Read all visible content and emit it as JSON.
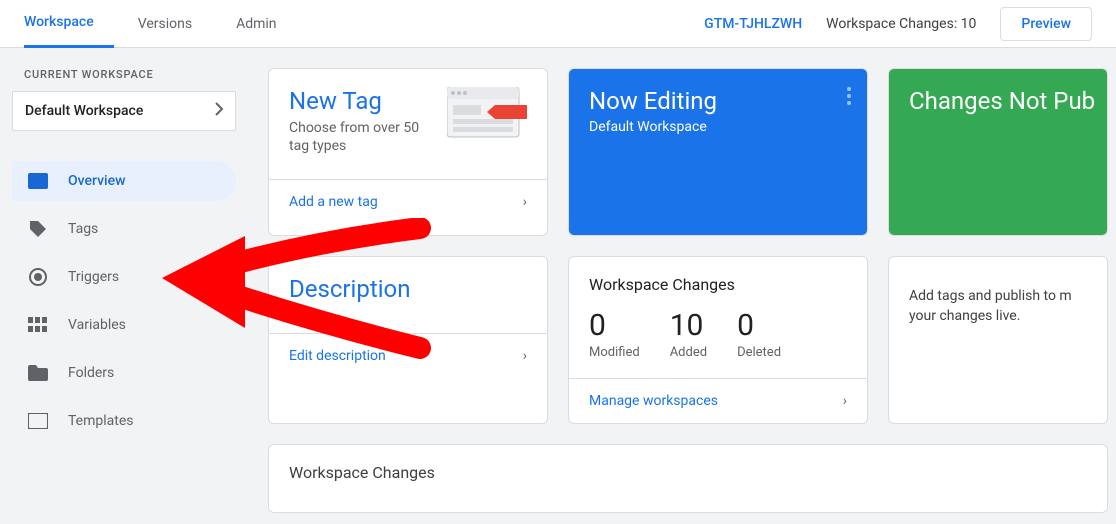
{
  "topbar": {
    "tabs": [
      "Workspace",
      "Versions",
      "Admin"
    ],
    "container_id": "GTM-TJHLZWH",
    "changes_label": "Workspace Changes: 10",
    "preview_btn": "Preview"
  },
  "sidebar": {
    "current_label": "CURRENT WORKSPACE",
    "workspace_name": "Default Workspace",
    "items": [
      {
        "label": "Overview",
        "icon": "folder-icon"
      },
      {
        "label": "Tags",
        "icon": "tag-icon"
      },
      {
        "label": "Triggers",
        "icon": "target-icon"
      },
      {
        "label": "Variables",
        "icon": "cells-icon"
      },
      {
        "label": "Folders",
        "icon": "folder-solid-icon"
      },
      {
        "label": "Templates",
        "icon": "template-icon"
      }
    ]
  },
  "cards": {
    "newtag": {
      "title": "New Tag",
      "subtitle": "Choose from over 50 tag types",
      "action": "Add a new tag"
    },
    "nowediting": {
      "title": "Now Editing",
      "subtitle": "Default Workspace"
    },
    "notpublished": {
      "title": "Changes Not Pub"
    },
    "description": {
      "title": "Description",
      "action": "Edit description"
    },
    "wschanges": {
      "title": "Workspace Changes",
      "stats": [
        {
          "num": "0",
          "label": "Modified"
        },
        {
          "num": "10",
          "label": "Added"
        },
        {
          "num": "0",
          "label": "Deleted"
        }
      ],
      "action": "Manage workspaces"
    },
    "publish_hint": "Add tags and publish to m\nyour changes live.",
    "bottom_title": "Workspace Changes"
  }
}
